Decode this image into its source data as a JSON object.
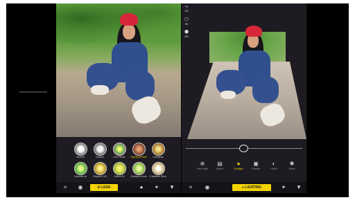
{
  "left_panel": {
    "filters": [
      {
        "label": "Normal",
        "color": "#e0e0e0"
      },
      {
        "label": "Custom",
        "color": "#d8d8d8"
      },
      {
        "label": "Lolo Dimar",
        "color": "#c6d04a"
      },
      {
        "label": "Olympus Rose",
        "color": "#b37a5c"
      },
      {
        "label": "Landarby",
        "color": "#c7a34f"
      },
      {
        "label": "Contrast on",
        "color": "#9bcf5a"
      },
      {
        "label": "Reghan 100",
        "color": "#d5c24a"
      },
      {
        "label": "Helios 44",
        "color": "#cfd23f"
      },
      {
        "label": "Cardaine Area",
        "color": "#b2ce4c"
      },
      {
        "label": "Cardaine Olive",
        "color": "#d6c9a0"
      }
    ],
    "toolbar": {
      "active_label": "LENS",
      "active_color": "#f3d400",
      "icons": [
        "crop-icon",
        "filter-icon",
        "lens-icon",
        "bulb-icon",
        "magic-wand-icon",
        "export-icon"
      ]
    }
  },
  "right_panel": {
    "sidebar": [
      {
        "label": "2D",
        "icon": "2d-icon"
      },
      {
        "label": "3D",
        "icon": "3d-icon"
      },
      {
        "label": "AR",
        "icon": "ar-icon"
      }
    ],
    "tools": [
      {
        "label": "New Light",
        "icon": "plus-icon"
      },
      {
        "label": "Delete",
        "icon": "trash-icon"
      },
      {
        "label": "Sunlight",
        "icon": "sun-icon",
        "active": true
      },
      {
        "label": "Shadow",
        "icon": "shadow-icon"
      },
      {
        "label": "Falloff",
        "icon": "falloff-icon"
      },
      {
        "label": "Shine",
        "icon": "shine-icon"
      }
    ],
    "slider_fraction": 0.5,
    "toolbar": {
      "active_label": "LIGHTING",
      "active_color": "#f3d400",
      "icons": [
        "crop-icon",
        "filter-icon",
        "lighting-icon",
        "magic-wand-icon",
        "export-icon"
      ]
    }
  }
}
